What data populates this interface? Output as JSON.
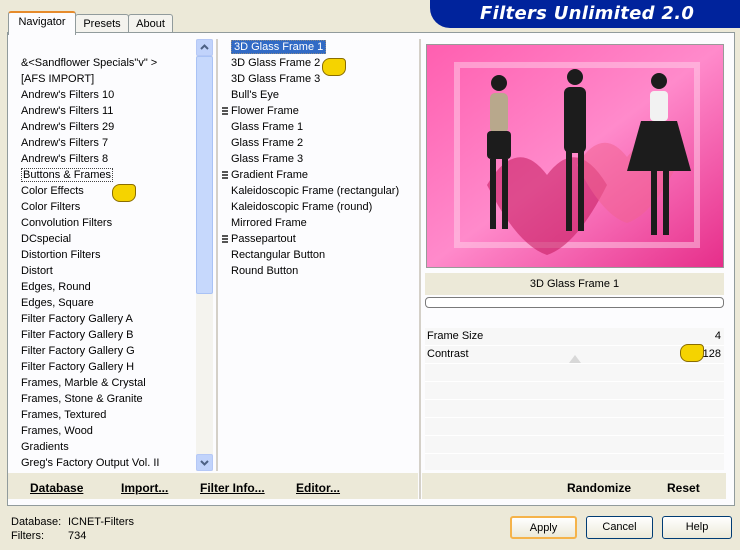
{
  "title": "Filters Unlimited 2.0",
  "tabs": [
    "Navigator",
    "Presets",
    "About"
  ],
  "categories": [
    "&<Sandflower Specials\"v\" >",
    "[AFS IMPORT]",
    "Andrew's Filters 10",
    "Andrew's Filters 11",
    "Andrew's Filters 29",
    "Andrew's Filters 7",
    "Andrew's Filters 8",
    "Buttons & Frames",
    "Color Effects",
    "Color Filters",
    "Convolution Filters",
    "DCspecial",
    "Distortion Filters",
    "Distort",
    "Edges, Round",
    "Edges, Square",
    "Filter Factory Gallery A",
    "Filter Factory Gallery B",
    "Filter Factory Gallery G",
    "Filter Factory Gallery H",
    "Frames, Marble & Crystal",
    "Frames, Stone & Granite",
    "Frames, Textured",
    "Frames, Wood",
    "Gradients",
    "Greg's Factory Output Vol. II"
  ],
  "filters": [
    {
      "label": "3D Glass Frame 1",
      "group": false
    },
    {
      "label": "3D Glass Frame 2",
      "group": false
    },
    {
      "label": "3D Glass Frame 3",
      "group": false
    },
    {
      "label": "Bull's Eye",
      "group": false
    },
    {
      "label": "Flower Frame",
      "group": true
    },
    {
      "label": "Glass Frame 1",
      "group": false
    },
    {
      "label": "Glass Frame 2",
      "group": false
    },
    {
      "label": "Glass Frame 3",
      "group": false
    },
    {
      "label": "Gradient Frame",
      "group": true
    },
    {
      "label": "Kaleidoscopic Frame (rectangular)",
      "group": false
    },
    {
      "label": "Kaleidoscopic Frame (round)",
      "group": false
    },
    {
      "label": "Mirrored Frame",
      "group": false
    },
    {
      "label": "Passepartout",
      "group": true
    },
    {
      "label": "Rectangular Button",
      "group": false
    },
    {
      "label": "Round Button",
      "group": false
    }
  ],
  "selected_category": "Buttons & Frames",
  "selected_filter": "3D Glass Frame 1",
  "filter_name": "3D Glass Frame 1",
  "params": [
    {
      "label": "Frame Size",
      "value": "4"
    },
    {
      "label": "Contrast",
      "value": "128"
    }
  ],
  "toolbar": {
    "database": "Database",
    "import": "Import...",
    "filter_info": "Filter Info...",
    "editor": "Editor...",
    "randomize": "Randomize",
    "reset": "Reset"
  },
  "status": {
    "database_label": "Database:",
    "database_value": "ICNET-Filters",
    "filters_label": "Filters:",
    "filters_value": "734"
  },
  "buttons": {
    "apply": "Apply",
    "cancel": "Cancel",
    "help": "Help"
  },
  "colors": {
    "accent": "#00239c",
    "selection": "#316ac5",
    "tab_highlight": "#e68b2c"
  }
}
